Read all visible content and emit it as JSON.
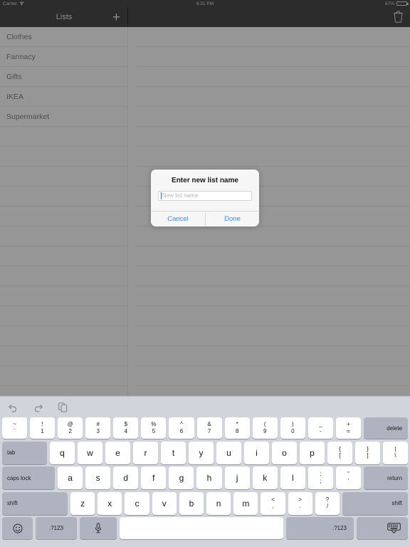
{
  "status_bar": {
    "carrier": "Carrier",
    "wifi_icon": "wifi-icon",
    "time": "9:31 PM",
    "battery_percent": "87%",
    "battery_icon": "battery-icon"
  },
  "navigation": {
    "left_title": "Lists",
    "add_icon": "+",
    "add_icon_name": "add-list-icon",
    "trash_icon_name": "trash-icon"
  },
  "sidebar": {
    "items": [
      {
        "label": "Clothes"
      },
      {
        "label": "Farmacy"
      },
      {
        "label": "Gifts"
      },
      {
        "label": "IKEA"
      },
      {
        "label": "Supermarket"
      }
    ],
    "empty_row_count": 13
  },
  "detail": {
    "empty_row_count": 18
  },
  "alert": {
    "title": "Enter new list name",
    "input_value": "",
    "input_placeholder": "New list name",
    "cancel_label": "Cancel",
    "done_label": "Done",
    "accent_color": "#3b8cf5"
  },
  "keyboard": {
    "toolbar": [
      {
        "icon": "undo-icon"
      },
      {
        "icon": "redo-icon"
      },
      {
        "icon": "paste-icon"
      }
    ],
    "row1": [
      {
        "sup": "~",
        "sub": "`"
      },
      {
        "sup": "!",
        "sub": "1"
      },
      {
        "sup": "@",
        "sub": "2"
      },
      {
        "sup": "#",
        "sub": "3"
      },
      {
        "sup": "$",
        "sub": "4"
      },
      {
        "sup": "%",
        "sub": "5"
      },
      {
        "sup": "^",
        "sub": "6"
      },
      {
        "sup": "&",
        "sub": "7"
      },
      {
        "sup": "*",
        "sub": "8"
      },
      {
        "sup": "(",
        "sub": "9"
      },
      {
        "sup": ")",
        "sub": "0"
      },
      {
        "sup": "_",
        "sub": "-"
      },
      {
        "sup": "+",
        "sub": "="
      }
    ],
    "delete_label": "delete",
    "tab_label": "tab",
    "row2_letters": [
      "q",
      "w",
      "e",
      "r",
      "t",
      "y",
      "u",
      "i",
      "o",
      "p"
    ],
    "row2_pairs": [
      {
        "sup": "{",
        "sub": "["
      },
      {
        "sup": "}",
        "sub": "]"
      },
      {
        "sup": "|",
        "sub": "\\"
      }
    ],
    "caps_label": "caps lock",
    "row3_letters": [
      "a",
      "s",
      "d",
      "f",
      "g",
      "h",
      "j",
      "k",
      "l"
    ],
    "row3_pairs": [
      {
        "sup": ":",
        "sub": ";"
      },
      {
        "sup": "”",
        "sub": "’"
      }
    ],
    "return_label": "return",
    "shift_left_label": "shift",
    "row4_letters": [
      "z",
      "x",
      "c",
      "v",
      "b",
      "n",
      "m"
    ],
    "row4_pairs": [
      {
        "sup": "<",
        "sub": ","
      },
      {
        "sup": ">",
        "sub": "."
      },
      {
        "sup": "?",
        "sub": "/"
      }
    ],
    "shift_right_label": "shift",
    "emoji_icon": "emoji-icon",
    "numeric_left_label": ".?123",
    "mic_icon": "microphone-icon",
    "space_label": "",
    "numeric_right_label": ".?123",
    "dismiss_icon": "keyboard-dismiss-icon"
  },
  "colors": {
    "nav_bar": "#2c2c2c",
    "dimmed_content": "#969696",
    "keyboard_bg": "#d1d4db",
    "key_white": "#ffffff",
    "key_modifier": "#aeb3bf"
  }
}
